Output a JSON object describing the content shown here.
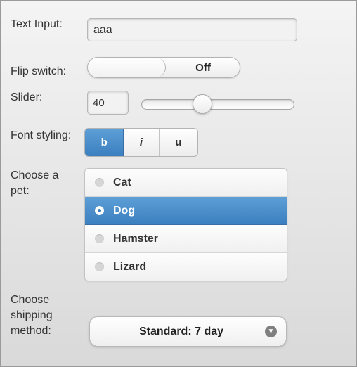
{
  "form": {
    "text_input": {
      "label": "Text Input:",
      "value": "aaa"
    },
    "flip_switch": {
      "label": "Flip switch:",
      "state_label": "Off"
    },
    "slider": {
      "label": "Slider:",
      "value": "40",
      "min": 0,
      "max": 100
    },
    "font_styling": {
      "label": "Font styling:",
      "buttons": [
        {
          "label": "b",
          "active": true
        },
        {
          "label": "i",
          "active": false
        },
        {
          "label": "u",
          "active": false
        }
      ]
    },
    "pet": {
      "label_line1": "Choose a",
      "label_line2": "pet:",
      "options": [
        {
          "label": "Cat"
        },
        {
          "label": "Dog"
        },
        {
          "label": "Hamster"
        },
        {
          "label": "Lizard"
        }
      ],
      "selected": "Dog"
    },
    "shipping": {
      "label_line1": "Choose",
      "label_line2": "shipping",
      "label_line3": "method:",
      "selected": "Standard: 7 day",
      "arrow_icon": "chevron-down-icon"
    }
  },
  "colors": {
    "accent": "#3c7fc0",
    "background_top": "#f4f4f4",
    "background_bottom": "#d9d9d9"
  }
}
